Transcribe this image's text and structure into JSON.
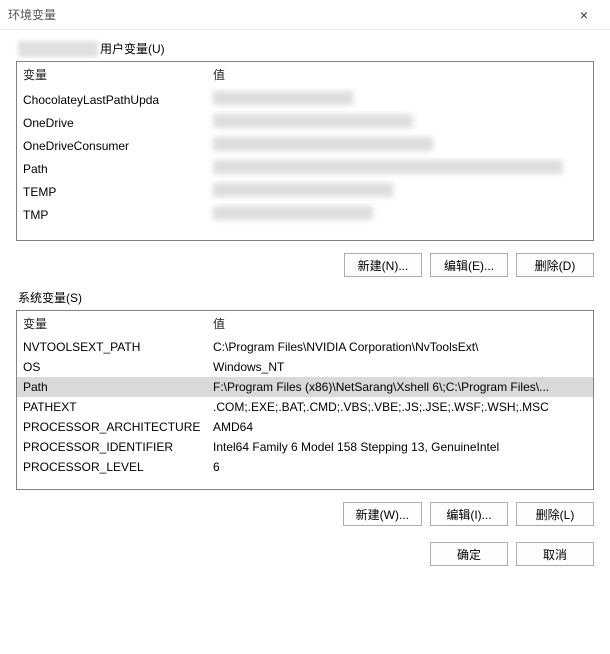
{
  "window": {
    "title": "环境变量",
    "close": "×"
  },
  "user_section": {
    "label_suffix": "用户变量(U)",
    "headers": {
      "name": "变量",
      "value": "值"
    },
    "rows": [
      {
        "name": "ChocolateyLastPathUpda"
      },
      {
        "name": "OneDrive"
      },
      {
        "name": "OneDriveConsumer"
      },
      {
        "name": "Path"
      },
      {
        "name": "TEMP"
      },
      {
        "name": "TMP"
      }
    ],
    "buttons": {
      "new": "新建(N)...",
      "edit": "编辑(E)...",
      "delete": "删除(D)"
    }
  },
  "system_section": {
    "label": "系统变量(S)",
    "headers": {
      "name": "变量",
      "value": "值"
    },
    "rows": [
      {
        "name": "NVTOOLSEXT_PATH",
        "value": "C:\\Program Files\\NVIDIA Corporation\\NvToolsExt\\"
      },
      {
        "name": "OS",
        "value": "Windows_NT"
      },
      {
        "name": "Path",
        "value": "F:\\Program Files (x86)\\NetSarang\\Xshell 6\\;C:\\Program Files\\...",
        "selected": true
      },
      {
        "name": "PATHEXT",
        "value": ".COM;.EXE;.BAT;.CMD;.VBS;.VBE;.JS;.JSE;.WSF;.WSH;.MSC"
      },
      {
        "name": "PROCESSOR_ARCHITECTURE",
        "value": "AMD64"
      },
      {
        "name": "PROCESSOR_IDENTIFIER",
        "value": "Intel64 Family 6 Model 158 Stepping 13, GenuineIntel"
      },
      {
        "name": "PROCESSOR_LEVEL",
        "value": "6"
      }
    ],
    "buttons": {
      "new": "新建(W)...",
      "edit": "编辑(I)...",
      "delete": "删除(L)"
    }
  },
  "dialog_buttons": {
    "ok": "确定",
    "cancel": "取消"
  }
}
